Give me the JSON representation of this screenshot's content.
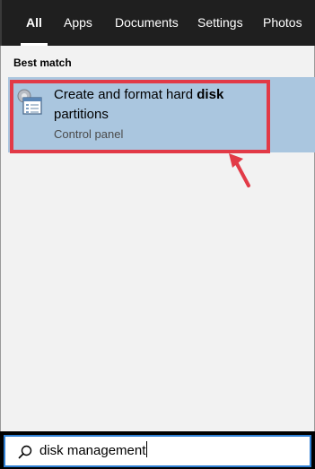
{
  "tabs": [
    {
      "label": "All",
      "active": true
    },
    {
      "label": "Apps"
    },
    {
      "label": "Documents"
    },
    {
      "label": "Settings"
    },
    {
      "label": "Photos"
    }
  ],
  "best_match": {
    "heading": "Best match",
    "result": {
      "title_prefix": "Create and format hard ",
      "title_bold": "disk",
      "title_suffix": "partitions",
      "subtitle": "Control panel",
      "icon": "control-panel-icon"
    }
  },
  "search": {
    "value": "disk management",
    "icon": "search-icon"
  },
  "colors": {
    "tabbar_bg": "#1f1f1f",
    "content_bg": "#f2f2f2",
    "selected_bg": "#aac6df",
    "highlight_red": "#e23a47",
    "search_border": "#2f7fd3"
  }
}
